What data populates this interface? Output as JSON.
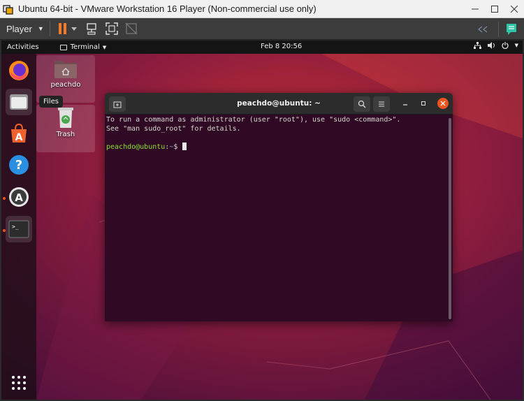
{
  "window": {
    "title": "Ubuntu 64-bit - VMware Workstation 16 Player (Non-commercial use only)",
    "minimize_icon": "minimize-icon",
    "maximize_icon": "maximize-icon",
    "close_icon": "close-icon"
  },
  "toolbar": {
    "player_label": "Player",
    "icons": [
      "pause-icon",
      "send-ctrl-alt-del-icon",
      "fullscreen-icon",
      "unity-icon",
      "message-log-icon"
    ],
    "accent": "#e95420"
  },
  "topbar": {
    "activities": "Activities",
    "app_menu": "Terminal",
    "clock": "Feb 8  20:56",
    "tray_icons": [
      "network-icon",
      "volume-icon",
      "power-icon"
    ]
  },
  "dock": {
    "items": [
      {
        "name": "firefox",
        "icon": "firefox-icon"
      },
      {
        "name": "files",
        "icon": "files-icon",
        "tooltip": "Files"
      },
      {
        "name": "software",
        "icon": "software-center-icon"
      },
      {
        "name": "help",
        "icon": "help-icon"
      },
      {
        "name": "software-updater",
        "icon": "software-updater-icon"
      },
      {
        "name": "terminal",
        "icon": "terminal-icon"
      }
    ],
    "show_apps_icon": "show-applications-icon"
  },
  "desktop": {
    "icons": [
      {
        "label": "peachdo",
        "icon": "home-folder-icon"
      },
      {
        "label": "Trash",
        "icon": "trash-icon"
      }
    ]
  },
  "terminal": {
    "title": "peachdo@ubuntu: ~",
    "lines": [
      "To run a command as administrator (user \"root\"), use \"sudo <command>\".",
      "See \"man sudo_root\" for details."
    ],
    "prompt_user": "peachdo@ubuntu",
    "prompt_sep": ":",
    "prompt_path": "~",
    "prompt_symbol": "$ ",
    "colors": {
      "background": "#300a24",
      "prompt_user": "#8ae234",
      "prompt_path": "#729fcf"
    }
  }
}
